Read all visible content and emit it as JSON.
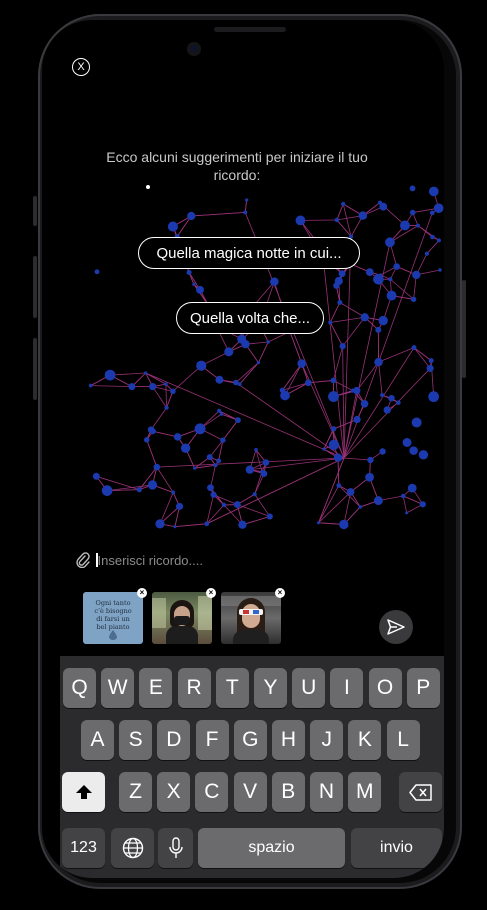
{
  "close_label": "X",
  "intro_text": "Ecco alcuni suggerimenti per iniziare il tuo ricordo:",
  "suggestions": [
    {
      "label": "Quella magica notte in cui..."
    },
    {
      "label": "Quella volta che..."
    }
  ],
  "input": {
    "placeholder": "Inserisci ricordo...."
  },
  "attachments": [
    {
      "caption": "Ogni tanto c’è bisogno di farsi un bel pianto"
    },
    {
      "icon": "woman-with-mask-photo"
    },
    {
      "icon": "woman-with-3d-glasses-photo"
    }
  ],
  "keyboard": {
    "row1": [
      "Q",
      "W",
      "E",
      "R",
      "T",
      "Y",
      "U",
      "I",
      "O",
      "P"
    ],
    "row2": [
      "A",
      "S",
      "D",
      "F",
      "G",
      "H",
      "J",
      "K",
      "L"
    ],
    "row3": [
      "Z",
      "X",
      "C",
      "V",
      "B",
      "N",
      "M"
    ],
    "numbers_label": "123",
    "space_label": "spazio",
    "return_label": "invio"
  },
  "colors": {
    "network_line": "#b23a8a",
    "network_node": "#1c3ab0",
    "accent_bg": "#7fa3c4"
  }
}
